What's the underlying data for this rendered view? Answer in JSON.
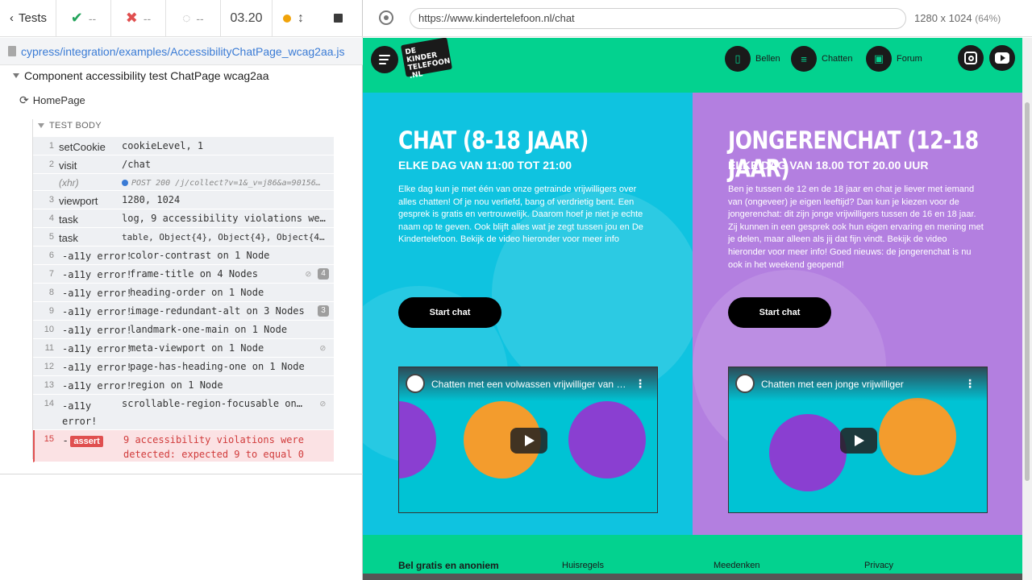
{
  "reporter": {
    "back_label": "Tests",
    "passed": "--",
    "failed": "--",
    "pending": "--",
    "duration": "03.20",
    "spec_file": "cypress/integration/examples/AccessibilityChatPage_wcag2aa.js",
    "suite_title": "Component accessibility test ChatPage wcag2aa",
    "test_title": "HomePage",
    "test_body_label": "TEST BODY",
    "commands": [
      {
        "num": "1",
        "name": "setCookie",
        "msg": "cookieLevel, 1"
      },
      {
        "num": "2",
        "name": "visit",
        "msg": "/chat"
      },
      {
        "num": "",
        "name": "(xhr)",
        "msg": "POST 200 /j/collect?v=1&_v=j86&a=90156…"
      },
      {
        "num": "3",
        "name": "viewport",
        "msg": "1280, 1024"
      },
      {
        "num": "4",
        "name": "task",
        "msg": "log, 9 accessibility violations we…"
      },
      {
        "num": "5",
        "name": "task",
        "msg": "table, Object{4}, Object{4}, Object{4}, O…"
      },
      {
        "num": "6",
        "name": "-a11y error!",
        "msg": "color-contrast on 1 Node"
      },
      {
        "num": "7",
        "name": "-a11y error!",
        "msg": "frame-title on 4 Nodes",
        "badge": "4"
      },
      {
        "num": "8",
        "name": "-a11y error!",
        "msg": "heading-order on 1 Node"
      },
      {
        "num": "9",
        "name": "-a11y error!",
        "msg": "image-redundant-alt on 3 Nodes",
        "badge": "3"
      },
      {
        "num": "10",
        "name": "-a11y error!",
        "msg": "landmark-one-main on 1 Node"
      },
      {
        "num": "11",
        "name": "-a11y error!",
        "msg": "meta-viewport on 1 Node"
      },
      {
        "num": "12",
        "name": "-a11y error!",
        "msg": "page-has-heading-one on 1 Node"
      },
      {
        "num": "13",
        "name": "-a11y error!",
        "msg": "region on 1 Node"
      },
      {
        "num": "14",
        "name": "-a11y error!",
        "msg": "scrollable-region-focusable on …"
      }
    ],
    "assert": {
      "num": "15",
      "prefix": "-",
      "tag": "assert",
      "msg": "9 accessibility violations were detected: expected 9 to equal 0"
    }
  },
  "aut": {
    "url": "https://www.kindertelefoon.nl/chat",
    "viewport": "1280 x 1024",
    "scale": "(64%)"
  },
  "site": {
    "logo_text": "DE KINDER TELEFOON .NL",
    "nav": {
      "call": "Bellen",
      "chat": "Chatten",
      "forum": "Forum"
    },
    "panels": [
      {
        "title": "CHAT (8-18 JAAR)",
        "subtitle": "ELKE DAG VAN 11:00 TOT 21:00",
        "description": "Elke dag kun je met één van onze getrainde vrijwilligers over alles chatten! Of je nou verliefd, bang of verdrietig bent. Een gesprek is gratis en vertrouwelijk. Daarom hoef je niet je echte naam op te geven. Ook blijft alles wat je zegt tussen jou en De Kindertelefoon. Bekijk de video hieronder voor meer info",
        "button": "Start chat",
        "video_title": "Chatten met een volwassen vrijwilliger van D…"
      },
      {
        "title": "JONGERENCHAT (12-18 JAAR)",
        "subtitle": "ELKE DAG VAN 18.00 TOT 20.00 UUR",
        "description": "Ben je tussen de 12 en de 18 jaar en chat je liever met iemand van (ongeveer) je eigen leeftijd? Dan kun je kiezen voor de jongerenchat: dit zijn jonge vrijwilligers tussen de 16 en 18 jaar. Zij kunnen in een gesprek ook hun eigen ervaring en mening met je delen, maar alleen als jij dat fijn vindt. Bekijk de video hieronder voor meer info! Goed nieuws: de jongerenchat is nu ook in het weekend geopend!",
        "button": "Start chat",
        "video_title": "Chatten met een jonge vrijwilliger"
      }
    ],
    "footer": {
      "col1": "Bel gratis en anoniem",
      "col2": "Huisregels",
      "col3": "Meedenken",
      "col4": "Privacy"
    }
  },
  "colors": {
    "green": "#03d28f",
    "cyan": "#0fc3e0",
    "purple": "#b37fe0",
    "error": "#e04f4f"
  }
}
